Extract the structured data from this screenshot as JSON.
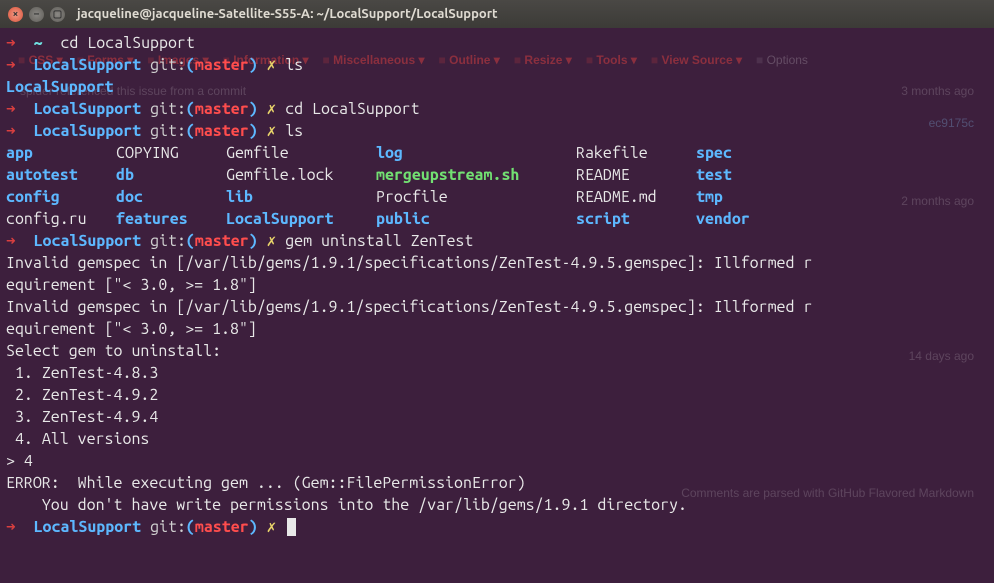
{
  "window": {
    "title": "jacqueline@jacqueline-Satellite-S55-A: ~/LocalSupport/LocalSupport"
  },
  "bg_toolbar": {
    "items": [
      "CSS",
      "Forms",
      "Images",
      "Information",
      "Miscellaneous",
      "Outline",
      "Resize",
      "Tools",
      "View Source",
      "Options"
    ]
  },
  "bg_hints": {
    "ref1": "spider referenced this issue from a commit",
    "ago1": "3 months ago",
    "commit": "ec9175c",
    "ago2": "2 months ago",
    "ago3": "14 days ago",
    "footer": "Comments are parsed with GitHub Flavored Markdown"
  },
  "prompt": {
    "arrow": "➜",
    "home": "~",
    "repo": "LocalSupport",
    "git": "git:",
    "openp": "(",
    "closep": ")",
    "branch": "master",
    "x": "✗"
  },
  "cmds": {
    "cd1": "cd LocalSupport",
    "ls1": "ls",
    "cd2": "cd LocalSupport",
    "ls2": "ls",
    "gem": "gem uninstall ZenTest"
  },
  "ls_out_short": {
    "line": "LocalSupport"
  },
  "ls_grid": {
    "r1": {
      "c1": "app",
      "c2": "COPYING",
      "c3": "Gemfile",
      "c4": "log",
      "c5": "Rakefile",
      "c6": "spec"
    },
    "r2": {
      "c1": "autotest",
      "c2": "db",
      "c3": "Gemfile.lock",
      "c4": "mergeupstream.sh",
      "c5": "README",
      "c6": "test"
    },
    "r3": {
      "c1": "config",
      "c2": "doc",
      "c3": "lib",
      "c4": "Procfile",
      "c5": "README.md",
      "c6": "tmp"
    },
    "r4": {
      "c1": "config.ru",
      "c2": "features",
      "c3": "LocalSupport",
      "c4": "public",
      "c5": "script",
      "c6": "vendor"
    }
  },
  "gem_out": {
    "err1a": "Invalid gemspec in [/var/lib/gems/1.9.1/specifications/ZenTest-4.9.5.gemspec]: Illformed r",
    "err1b": "equirement [\"< 3.0, >= 1.8\"]",
    "err2a": "Invalid gemspec in [/var/lib/gems/1.9.1/specifications/ZenTest-4.9.5.gemspec]: Illformed r",
    "err2b": "equirement [\"< 3.0, >= 1.8\"]",
    "blank": "",
    "select": "Select gem to uninstall:",
    "o1": " 1. ZenTest-4.8.3",
    "o2": " 2. ZenTest-4.9.2",
    "o3": " 3. ZenTest-4.9.4",
    "o4": " 4. All versions",
    "input": "> 4",
    "perr1": "ERROR:  While executing gem ... (Gem::FilePermissionError)",
    "perr2": "    You don't have write permissions into the /var/lib/gems/1.9.1 directory."
  }
}
